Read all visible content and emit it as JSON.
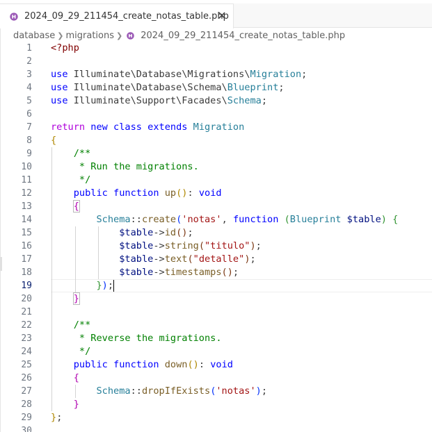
{
  "tab": {
    "label": "2024_09_29_211454_create_notas_table.php",
    "close": "✕"
  },
  "breadcrumb": [
    "database",
    "migrations",
    "2024_09_29_211454_create_notas_table.php"
  ],
  "editor": {
    "active_line": 19,
    "line_numbers": [
      "1",
      "2",
      "3",
      "4",
      "5",
      "6",
      "7",
      "8",
      "9",
      "10",
      "11",
      "12",
      "13",
      "14",
      "15",
      "16",
      "17",
      "18",
      "19",
      "20",
      "21",
      "22",
      "23",
      "24",
      "25",
      "26",
      "27",
      "28",
      "29",
      "30"
    ]
  },
  "colors": {
    "keyword": "#0000ff",
    "class": "#267f99",
    "function": "#795e26",
    "variable": "#001080",
    "string": "#a31515",
    "comment": "#008000"
  },
  "code": [
    [
      {
        "t": "<?php",
        "c": "t-tag"
      }
    ],
    [],
    [
      {
        "t": "use",
        "c": "t-kw"
      },
      {
        "t": " Illuminate\\Database\\Migrations\\",
        "c": "t-ns"
      },
      {
        "t": "Migration",
        "c": "t-cls"
      },
      {
        "t": ";",
        "c": "t-ns"
      }
    ],
    [
      {
        "t": "use",
        "c": "t-kw"
      },
      {
        "t": " Illuminate\\Database\\Schema\\",
        "c": "t-ns"
      },
      {
        "t": "Blueprint",
        "c": "t-cls"
      },
      {
        "t": ";",
        "c": "t-ns"
      }
    ],
    [
      {
        "t": "use",
        "c": "t-kw"
      },
      {
        "t": " Illuminate\\Support\\Facades\\",
        "c": "t-ns"
      },
      {
        "t": "Schema",
        "c": "t-cls"
      },
      {
        "t": ";",
        "c": "t-ns"
      }
    ],
    [],
    [
      {
        "t": "return",
        "c": "t-ctrl"
      },
      {
        "t": " ",
        "c": ""
      },
      {
        "t": "new",
        "c": "t-kw"
      },
      {
        "t": " ",
        "c": ""
      },
      {
        "t": "class",
        "c": "t-kw"
      },
      {
        "t": " ",
        "c": ""
      },
      {
        "t": "extends",
        "c": "t-kw"
      },
      {
        "t": " ",
        "c": ""
      },
      {
        "t": "Migration",
        "c": "t-cls"
      }
    ],
    [
      {
        "t": "{",
        "c": "t-gold"
      }
    ],
    [
      {
        "t": "    /**",
        "c": "t-cmt"
      }
    ],
    [
      {
        "t": "     * Run the migrations.",
        "c": "t-cmt"
      }
    ],
    [
      {
        "t": "     */",
        "c": "t-cmt"
      }
    ],
    [
      {
        "t": "    ",
        "c": ""
      },
      {
        "t": "public",
        "c": "t-kw"
      },
      {
        "t": " ",
        "c": ""
      },
      {
        "t": "function",
        "c": "t-kw"
      },
      {
        "t": " ",
        "c": ""
      },
      {
        "t": "up",
        "c": "t-fn"
      },
      {
        "t": "()",
        "c": "t-gold"
      },
      {
        "t": ": ",
        "c": "t-ns"
      },
      {
        "t": "void",
        "c": "t-kw"
      }
    ],
    [
      {
        "t": "    ",
        "c": ""
      },
      {
        "t": "{",
        "c": "t-pink bracket-match"
      }
    ],
    [
      {
        "t": "        ",
        "c": ""
      },
      {
        "t": "Schema",
        "c": "t-cls"
      },
      {
        "t": "::",
        "c": "t-ns"
      },
      {
        "t": "create",
        "c": "t-fn"
      },
      {
        "t": "(",
        "c": "t-b1"
      },
      {
        "t": "'notas'",
        "c": "t-str"
      },
      {
        "t": ", ",
        "c": "t-ns"
      },
      {
        "t": "function",
        "c": "t-kw"
      },
      {
        "t": " ",
        "c": ""
      },
      {
        "t": "(",
        "c": "t-b2"
      },
      {
        "t": "Blueprint",
        "c": "t-cls"
      },
      {
        "t": " ",
        "c": ""
      },
      {
        "t": "$table",
        "c": "t-var"
      },
      {
        "t": ")",
        "c": "t-b2"
      },
      {
        "t": " ",
        "c": ""
      },
      {
        "t": "{",
        "c": "t-b2"
      }
    ],
    [
      {
        "t": "            ",
        "c": ""
      },
      {
        "t": "$table",
        "c": "t-var"
      },
      {
        "t": "->",
        "c": "t-ns"
      },
      {
        "t": "id",
        "c": "t-fn"
      },
      {
        "t": "()",
        "c": "t-b3"
      },
      {
        "t": ";",
        "c": "t-ns"
      }
    ],
    [
      {
        "t": "            ",
        "c": ""
      },
      {
        "t": "$table",
        "c": "t-var"
      },
      {
        "t": "->",
        "c": "t-ns"
      },
      {
        "t": "string",
        "c": "t-fn"
      },
      {
        "t": "(",
        "c": "t-b3"
      },
      {
        "t": "\"titulo\"",
        "c": "t-str"
      },
      {
        "t": ")",
        "c": "t-b3"
      },
      {
        "t": ";",
        "c": "t-ns"
      }
    ],
    [
      {
        "t": "            ",
        "c": ""
      },
      {
        "t": "$table",
        "c": "t-var"
      },
      {
        "t": "->",
        "c": "t-ns"
      },
      {
        "t": "text",
        "c": "t-fn"
      },
      {
        "t": "(",
        "c": "t-b3"
      },
      {
        "t": "\"detalle\"",
        "c": "t-str"
      },
      {
        "t": ")",
        "c": "t-b3"
      },
      {
        "t": ";",
        "c": "t-ns"
      }
    ],
    [
      {
        "t": "            ",
        "c": ""
      },
      {
        "t": "$table",
        "c": "t-var"
      },
      {
        "t": "->",
        "c": "t-ns"
      },
      {
        "t": "timestamps",
        "c": "t-fn"
      },
      {
        "t": "()",
        "c": "t-b3"
      },
      {
        "t": ";",
        "c": "t-ns"
      }
    ],
    [
      {
        "t": "        ",
        "c": ""
      },
      {
        "t": "}",
        "c": "t-b2"
      },
      {
        "t": ")",
        "c": "t-b1"
      },
      {
        "t": ";",
        "c": "t-ns"
      },
      {
        "t": "",
        "c": "cursor"
      }
    ],
    [
      {
        "t": "    ",
        "c": ""
      },
      {
        "t": "}",
        "c": "t-pink bracket-match"
      }
    ],
    [],
    [
      {
        "t": "    /**",
        "c": "t-cmt"
      }
    ],
    [
      {
        "t": "     * Reverse the migrations.",
        "c": "t-cmt"
      }
    ],
    [
      {
        "t": "     */",
        "c": "t-cmt"
      }
    ],
    [
      {
        "t": "    ",
        "c": ""
      },
      {
        "t": "public",
        "c": "t-kw"
      },
      {
        "t": " ",
        "c": ""
      },
      {
        "t": "function",
        "c": "t-kw"
      },
      {
        "t": " ",
        "c": ""
      },
      {
        "t": "down",
        "c": "t-fn"
      },
      {
        "t": "()",
        "c": "t-gold"
      },
      {
        "t": ": ",
        "c": "t-ns"
      },
      {
        "t": "void",
        "c": "t-kw"
      }
    ],
    [
      {
        "t": "    ",
        "c": ""
      },
      {
        "t": "{",
        "c": "t-pink"
      }
    ],
    [
      {
        "t": "        ",
        "c": ""
      },
      {
        "t": "Schema",
        "c": "t-cls"
      },
      {
        "t": "::",
        "c": "t-ns"
      },
      {
        "t": "dropIfExists",
        "c": "t-fn"
      },
      {
        "t": "(",
        "c": "t-b1"
      },
      {
        "t": "'notas'",
        "c": "t-str"
      },
      {
        "t": ")",
        "c": "t-b1"
      },
      {
        "t": ";",
        "c": "t-ns"
      }
    ],
    [
      {
        "t": "    ",
        "c": ""
      },
      {
        "t": "}",
        "c": "t-pink"
      }
    ],
    [
      {
        "t": "}",
        "c": "t-gold"
      },
      {
        "t": ";",
        "c": "t-ns"
      }
    ],
    []
  ]
}
